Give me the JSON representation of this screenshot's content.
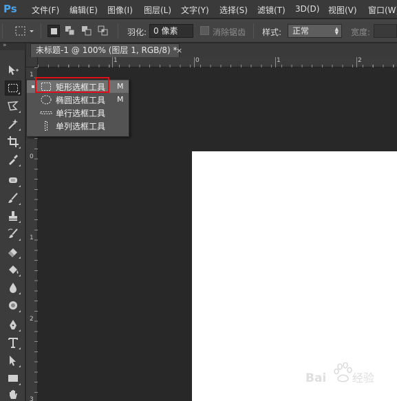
{
  "app": {
    "logo": "Ps",
    "menus": [
      "文件(F)",
      "编辑(E)",
      "图像(I)",
      "图层(L)",
      "文字(Y)",
      "选择(S)",
      "滤镜(T)",
      "3D(D)",
      "视图(V)",
      "窗口(W)"
    ]
  },
  "options": {
    "feather_label": "羽化:",
    "feather_value": "0 像素",
    "antialias_label": "消除锯齿",
    "style_label": "样式:",
    "style_value": "正常",
    "width_label": "宽度:"
  },
  "document": {
    "tab_title": "未标题-1 @ 100% (图层 1, RGB/8) *",
    "close_glyph": "×"
  },
  "rulers": {
    "top_labels": [
      "1",
      "0",
      "1",
      "2"
    ],
    "left_labels": [
      "1",
      "0",
      "1",
      "2",
      "3"
    ]
  },
  "flyout": {
    "items": [
      {
        "label": "矩形选框工具",
        "shortcut": "M",
        "icon": "rect-marquee-icon"
      },
      {
        "label": "椭圆选框工具",
        "shortcut": "M",
        "icon": "ellipse-marquee-icon"
      },
      {
        "label": "单行选框工具",
        "shortcut": "",
        "icon": "single-row-marquee-icon"
      },
      {
        "label": "单列选框工具",
        "shortcut": "",
        "icon": "single-column-marquee-icon"
      }
    ]
  },
  "toolbox": {
    "tools": [
      "move-icon",
      "marquee-icon",
      "lasso-icon",
      "magic-wand-icon",
      "crop-icon",
      "eyedropper-icon",
      "healing-icon",
      "brush-icon",
      "stamp-icon",
      "history-brush-icon",
      "eraser-icon",
      "paint-bucket-icon",
      "blur-icon",
      "dodge-icon",
      "pen-icon",
      "type-icon",
      "path-select-icon",
      "rectangle-shape-icon",
      "hand-icon"
    ]
  },
  "colors": {
    "accent_highlight": "#e0101a",
    "logo_blue": "#4aa2e8"
  }
}
